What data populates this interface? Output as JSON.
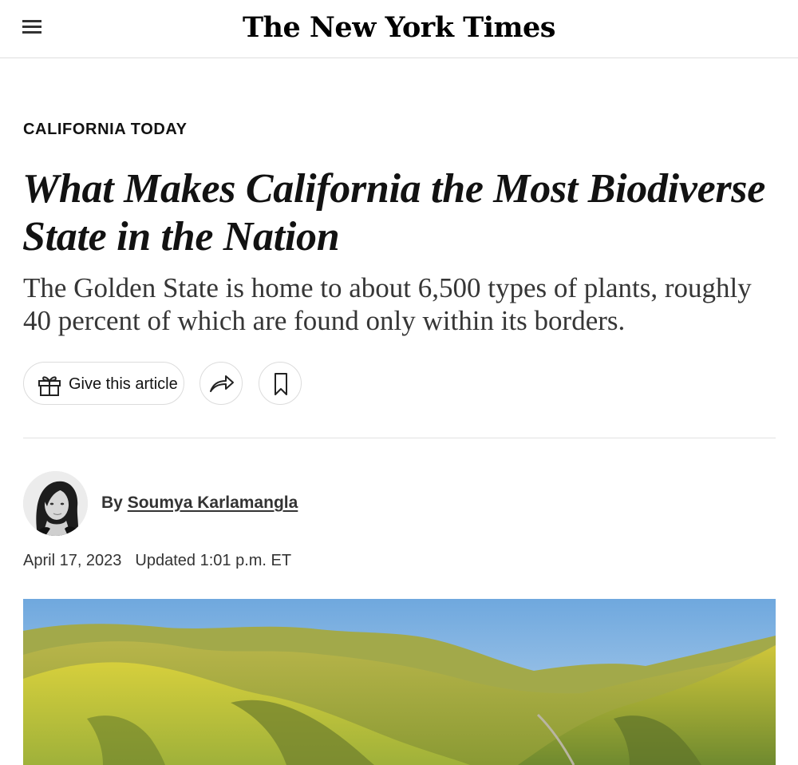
{
  "header": {
    "logo_text": "The New York Times",
    "menu_icon": "hamburger-menu-icon"
  },
  "article": {
    "kicker": "CALIFORNIA TODAY",
    "headline": "What Makes California the Most Biodiverse State in the Nation",
    "summary": "The Golden State is home to about 6,500 types of plants, roughly 40 percent of which are found only within its borders.",
    "actions": {
      "gift_label": "Give this article",
      "gift_icon": "gift-icon",
      "share_icon": "share-arrow-icon",
      "save_icon": "bookmark-icon"
    },
    "byline": {
      "prefix": "By",
      "author": "Soumya Karlamangla"
    },
    "date": "April 17, 2023",
    "updated": "Updated 1:01 p.m. ET"
  },
  "colors": {
    "text": "#121212",
    "summary_text": "#363636",
    "border": "#dcdcdc",
    "sky": "#7fb4e3",
    "hills_yellow": "#c9c23a",
    "hills_green": "#6f8f3a"
  }
}
